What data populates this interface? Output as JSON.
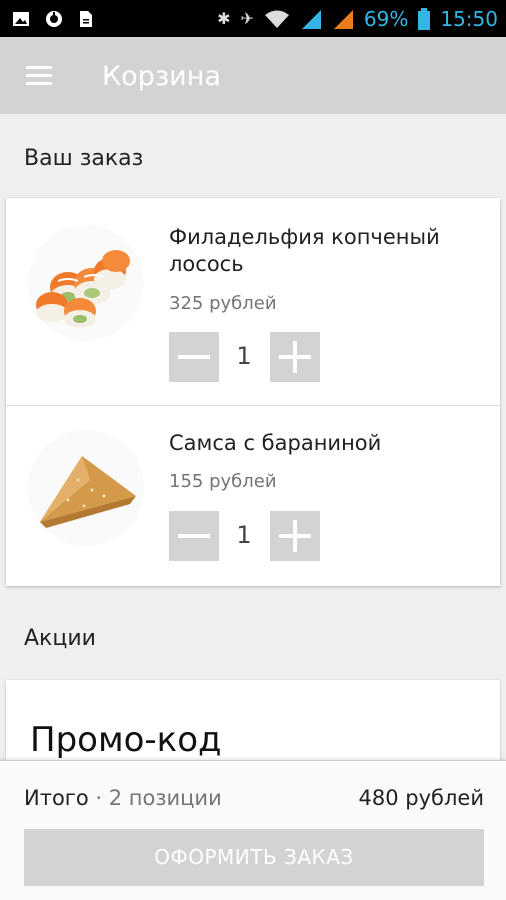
{
  "status_bar": {
    "icons_left": [
      "image-icon",
      "sync-icon",
      "file-icon"
    ],
    "icons_right": [
      "bluetooth-icon",
      "vibrate-icon",
      "wifi-icon",
      "signal-icon",
      "signal2-icon"
    ],
    "battery": "69%",
    "time": "15:50"
  },
  "app_bar": {
    "title": "Корзина",
    "menu_icon": "hamburger-menu-icon"
  },
  "order": {
    "section_title": "Ваш заказ",
    "items": [
      {
        "name": "Филадельфия копченый лосось",
        "price": "325 рублей",
        "quantity": "1",
        "image": "sushi-roll-image"
      },
      {
        "name": "Самса с бараниной",
        "price": "155 рублей",
        "quantity": "1",
        "image": "samsa-image"
      }
    ]
  },
  "promos": {
    "section_title": "Акции",
    "promo_code_title": "Промо-код"
  },
  "summary": {
    "total_label": "Итого",
    "separator": " · ",
    "count": "2 позиции",
    "total_sum": "480 рублей",
    "checkout_label": "ОФОРМИТЬ ЗАКАЗ"
  },
  "colors": {
    "status_accent": "#33b5e5",
    "app_bar": "#d3d3d3",
    "background": "#efefef",
    "button_disabled": "#d3d3d3"
  }
}
